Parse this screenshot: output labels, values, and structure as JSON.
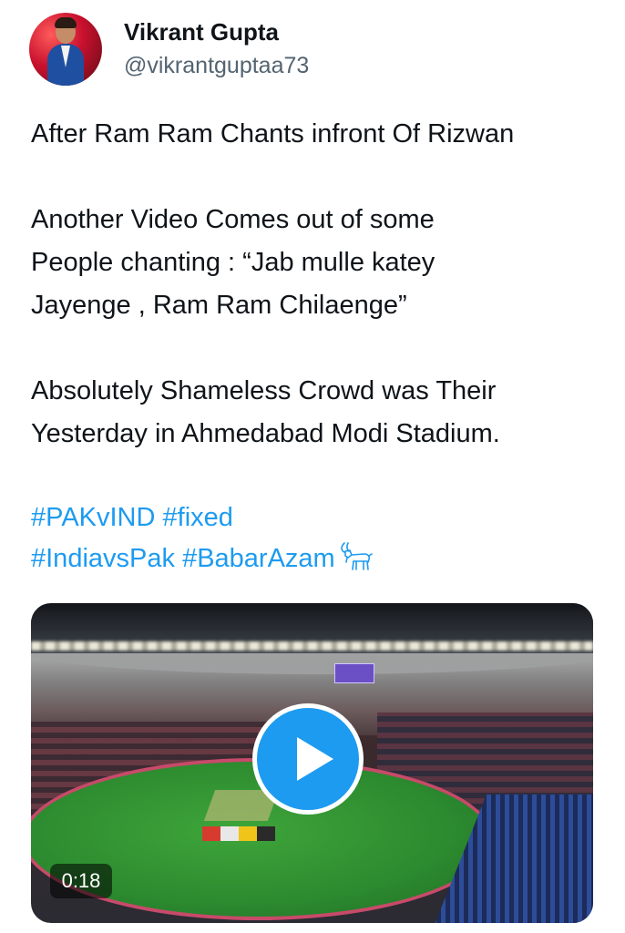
{
  "author": {
    "display_name": "Vikrant Gupta",
    "handle": "@vikrantguptaa73"
  },
  "tweet": {
    "paragraphs": [
      [
        "After Ram Ram Chants infront Of Rizwan"
      ],
      [
        "Another Video Comes out of some",
        "People chanting : “Jab mulle katey",
        "Jayenge , Ram Ram Chilaenge”"
      ],
      [
        "Absolutely Shameless Crowd was Their",
        "Yesterday in Ahmedabad Modi Stadium."
      ]
    ],
    "hashtags": [
      "#PAKvIND",
      "#fixed",
      "#IndiavsPak",
      "#BabarAzam"
    ],
    "emoji": "goat-icon"
  },
  "media": {
    "type": "video",
    "duration": "0:18",
    "icon": "play-icon"
  },
  "colors": {
    "link": "#1d9bf0",
    "text": "#0f1419",
    "secondary": "#536471",
    "play_button": "#1d9bf0"
  }
}
